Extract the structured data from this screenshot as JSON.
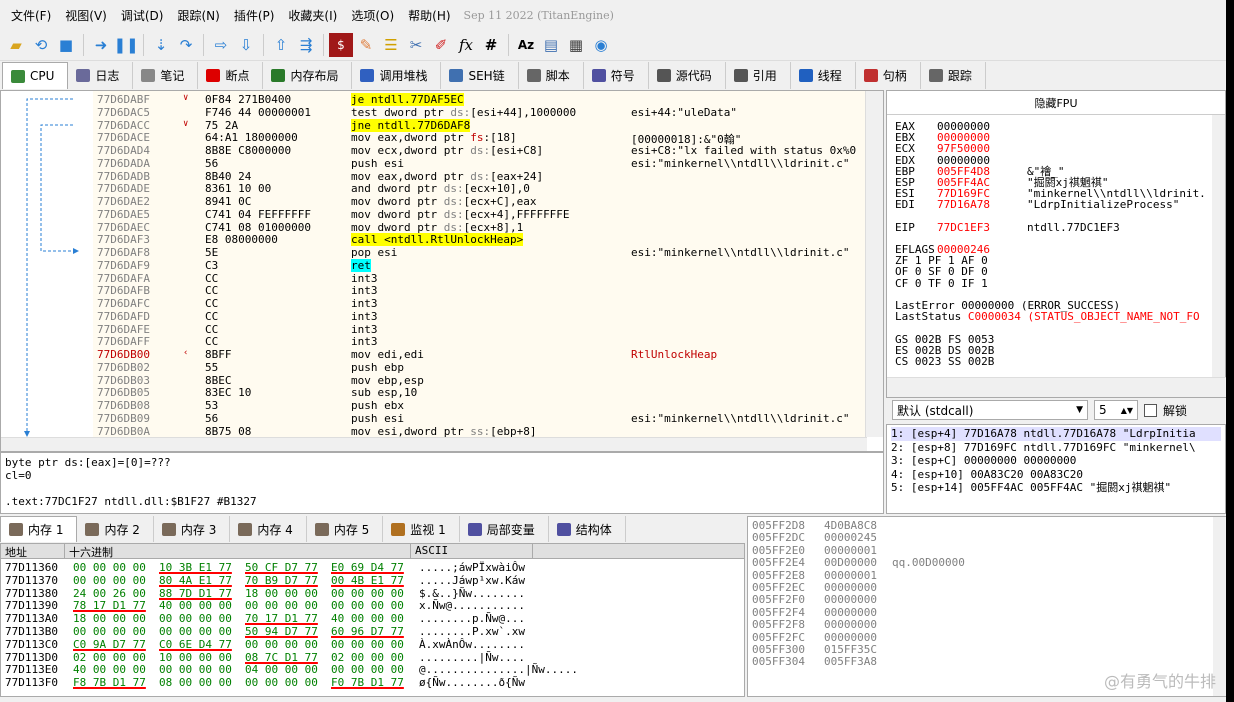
{
  "menubar": {
    "items": [
      "文件(F)",
      "视图(V)",
      "调试(D)",
      "跟踪(N)",
      "插件(P)",
      "收藏夹(I)",
      "选项(O)",
      "帮助(H)"
    ],
    "title": "Sep 11 2022 (TitanEngine)"
  },
  "tabs": [
    {
      "label": "CPU",
      "icon": "cpu-icon",
      "color": "#3a8a3a"
    },
    {
      "label": "日志",
      "icon": "log-icon",
      "color": "#6a6a9a"
    },
    {
      "label": "笔记",
      "icon": "notes-icon",
      "color": "#888"
    },
    {
      "label": "断点",
      "icon": "breakpoint-icon",
      "color": "#d00"
    },
    {
      "label": "内存布局",
      "icon": "memory-map-icon",
      "color": "#2a7a2a"
    },
    {
      "label": "调用堆栈",
      "icon": "call-stack-icon",
      "color": "#3060c0"
    },
    {
      "label": "SEH链",
      "icon": "seh-icon",
      "color": "#4070b0"
    },
    {
      "label": "脚本",
      "icon": "script-icon",
      "color": "#666"
    },
    {
      "label": "符号",
      "icon": "symbols-icon",
      "color": "#5050a0"
    },
    {
      "label": "源代码",
      "icon": "source-icon",
      "color": "#555"
    },
    {
      "label": "引用",
      "icon": "references-icon",
      "color": "#555"
    },
    {
      "label": "线程",
      "icon": "threads-icon",
      "color": "#2060c0"
    },
    {
      "label": "句柄",
      "icon": "handles-icon",
      "color": "#c03030"
    },
    {
      "label": "跟踪",
      "icon": "trace-icon",
      "color": "#666"
    }
  ],
  "disasm": [
    {
      "addr": "77D6DABF",
      "mark": "∨",
      "bytes": "0F84 271B0400",
      "ins": [
        [
          "j",
          "je ntdll.77DAF5EC"
        ]
      ],
      "cmt": ""
    },
    {
      "addr": "77D6DAC5",
      "mark": "",
      "bytes": "F746 44 00000001",
      "ins": [
        [
          "t",
          "test dword ptr "
        ],
        [
          "s",
          "ds:"
        ],
        [
          "t",
          "[esi+44],1000000"
        ]
      ],
      "cmt": "esi+44:\"uleData\""
    },
    {
      "addr": "77D6DACC",
      "mark": "∨",
      "bytes": "75 2A",
      "ins": [
        [
          "j",
          "jne ntdll.77D6DAF8"
        ]
      ],
      "cmt": ""
    },
    {
      "addr": "77D6DACE",
      "mark": "",
      "bytes": "64:A1 18000000",
      "ins": [
        [
          "t",
          "mov eax,dword ptr "
        ],
        [
          "r",
          "fs"
        ],
        [
          "t",
          ":[18]"
        ]
      ],
      "cmt": "[00000018]:&\"0翰\""
    },
    {
      "addr": "77D6DAD4",
      "mark": "",
      "bytes": "8B8E C8000000",
      "ins": [
        [
          "t",
          "mov ecx,dword ptr "
        ],
        [
          "s",
          "ds:"
        ],
        [
          "t",
          "[esi+C8]"
        ]
      ],
      "cmt": "esi+C8:\"lx failed with status 0x%0"
    },
    {
      "addr": "77D6DADA",
      "mark": "",
      "bytes": "56",
      "ins": [
        [
          "t",
          "push esi"
        ]
      ],
      "cmt": "esi:\"minkernel\\\\ntdll\\\\ldrinit.c\""
    },
    {
      "addr": "77D6DADB",
      "mark": "",
      "bytes": "8B40 24",
      "ins": [
        [
          "t",
          "mov eax,dword ptr "
        ],
        [
          "s",
          "ds:"
        ],
        [
          "t",
          "[eax+24]"
        ]
      ],
      "cmt": ""
    },
    {
      "addr": "77D6DADE",
      "mark": "",
      "bytes": "8361 10 00",
      "ins": [
        [
          "t",
          "and dword ptr "
        ],
        [
          "s",
          "ds:"
        ],
        [
          "t",
          "[ecx+10],0"
        ]
      ],
      "cmt": ""
    },
    {
      "addr": "77D6DAE2",
      "mark": "",
      "bytes": "8941 0C",
      "ins": [
        [
          "t",
          "mov dword ptr "
        ],
        [
          "s",
          "ds:"
        ],
        [
          "t",
          "[ecx+C],eax"
        ]
      ],
      "cmt": ""
    },
    {
      "addr": "77D6DAE5",
      "mark": "",
      "bytes": "C741 04 FEFFFFFF",
      "ins": [
        [
          "t",
          "mov dword ptr "
        ],
        [
          "s",
          "ds:"
        ],
        [
          "t",
          "[ecx+4],FFFFFFFE"
        ]
      ],
      "cmt": ""
    },
    {
      "addr": "77D6DAEC",
      "mark": "",
      "bytes": "C741 08 01000000",
      "ins": [
        [
          "t",
          "mov dword ptr "
        ],
        [
          "s",
          "ds:"
        ],
        [
          "t",
          "[ecx+8],1"
        ]
      ],
      "cmt": ""
    },
    {
      "addr": "77D6DAF3",
      "mark": "",
      "bytes": "E8 08000000",
      "ins": [
        [
          "c",
          "call <ntdll.RtlUnlockHeap>"
        ]
      ],
      "cmt": ""
    },
    {
      "addr": "77D6DAF8",
      "mark": "",
      "bytes": "5E",
      "ins": [
        [
          "t",
          "pop esi"
        ]
      ],
      "cmt": "esi:\"minkernel\\\\ntdll\\\\ldrinit.c\""
    },
    {
      "addr": "77D6DAF9",
      "mark": "",
      "bytes": "C3",
      "ins": [
        [
          "x",
          "ret"
        ]
      ],
      "cmt": ""
    },
    {
      "addr": "77D6DAFA",
      "mark": "",
      "bytes": "CC",
      "ins": [
        [
          "t",
          "int3"
        ]
      ],
      "cmt": ""
    },
    {
      "addr": "77D6DAFB",
      "mark": "",
      "bytes": "CC",
      "ins": [
        [
          "t",
          "int3"
        ]
      ],
      "cmt": ""
    },
    {
      "addr": "77D6DAFC",
      "mark": "",
      "bytes": "CC",
      "ins": [
        [
          "t",
          "int3"
        ]
      ],
      "cmt": ""
    },
    {
      "addr": "77D6DAFD",
      "mark": "",
      "bytes": "CC",
      "ins": [
        [
          "t",
          "int3"
        ]
      ],
      "cmt": ""
    },
    {
      "addr": "77D6DAFE",
      "mark": "",
      "bytes": "CC",
      "ins": [
        [
          "t",
          "int3"
        ]
      ],
      "cmt": ""
    },
    {
      "addr": "77D6DAFF",
      "mark": "",
      "bytes": "CC",
      "ins": [
        [
          "t",
          "int3"
        ]
      ],
      "cmt": ""
    },
    {
      "addr": "77D6DB00",
      "mark": "‹",
      "bytes": "8BFF",
      "ins": [
        [
          "t",
          "mov edi,edi"
        ]
      ],
      "cmt": "RtlUnlockHeap",
      "hl": true
    },
    {
      "addr": "77D6DB02",
      "mark": "",
      "bytes": "55",
      "ins": [
        [
          "t",
          "push ebp"
        ]
      ],
      "cmt": ""
    },
    {
      "addr": "77D6DB03",
      "mark": "",
      "bytes": "8BEC",
      "ins": [
        [
          "t",
          "mov ebp,esp"
        ]
      ],
      "cmt": ""
    },
    {
      "addr": "77D6DB05",
      "mark": "",
      "bytes": "83EC 10",
      "ins": [
        [
          "t",
          "sub esp,10"
        ]
      ],
      "cmt": ""
    },
    {
      "addr": "77D6DB08",
      "mark": "",
      "bytes": "53",
      "ins": [
        [
          "t",
          "push ebx"
        ]
      ],
      "cmt": ""
    },
    {
      "addr": "77D6DB09",
      "mark": "",
      "bytes": "56",
      "ins": [
        [
          "t",
          "push esi"
        ]
      ],
      "cmt": "esi:\"minkernel\\\\ntdll\\\\ldrinit.c\""
    },
    {
      "addr": "77D6DB0A",
      "mark": "",
      "bytes": "8B75 08",
      "ins": [
        [
          "t",
          "mov esi,dword ptr "
        ],
        [
          "s",
          "ss:"
        ],
        [
          "t",
          "[ebp+8]"
        ]
      ],
      "cmt": ""
    }
  ],
  "info": {
    "line1": "byte ptr ds:[eax]=[0]=???",
    "line2": "cl=0",
    "line3": ".text:77DC1F27 ntdll.dll:$B1F27 #B1327"
  },
  "regs": {
    "title": "隐藏FPU",
    "gp": [
      {
        "n": "EAX",
        "v": "00000000",
        "c": "",
        "red": false
      },
      {
        "n": "EBX",
        "v": "00000000",
        "c": "",
        "red": true
      },
      {
        "n": "ECX",
        "v": "97F50000",
        "c": "",
        "red": true
      },
      {
        "n": "EDX",
        "v": "00000000",
        "c": "",
        "red": false
      },
      {
        "n": "EBP",
        "v": "005FF4D8",
        "c": "&\"襘_\"",
        "red": true
      },
      {
        "n": "ESP",
        "v": "005FF4AC",
        "c": "\"掘閼xj祺魍祺\"",
        "red": true
      },
      {
        "n": "ESI",
        "v": "77D169FC",
        "c": "\"minkernel\\\\ntdll\\\\ldrinit.",
        "red": true
      },
      {
        "n": "EDI",
        "v": "77D16A78",
        "c": "\"LdrpInitializeProcess\"",
        "red": true
      }
    ],
    "eip": {
      "n": "EIP",
      "v": "77DC1EF3",
      "c": "ntdll.77DC1EF3"
    },
    "eflags": {
      "n": "EFLAGS",
      "v": "00000246"
    },
    "flags": [
      "ZF 1  PF 1  AF 0",
      "OF 0  SF 0  DF 0",
      "CF 0  TF 0  IF 1"
    ],
    "lasterror": {
      "n": "LastError",
      "v": "00000000 (ERROR_SUCCESS)"
    },
    "laststatus": {
      "n": "LastStatus",
      "v": "C0000034 (STATUS_OBJECT_NAME_NOT_FO"
    },
    "segs": [
      "GS 002B  FS 0053",
      "ES 002B  DS 002B",
      "CS 0023  SS 002B"
    ]
  },
  "callconv": {
    "label": "默认 (stdcall)",
    "count": "5",
    "unlock": "解锁"
  },
  "stackargs": [
    "1: [esp+4] 77D16A78 ntdll.77D16A78 \"LdrpInitia",
    "2: [esp+8] 77D169FC ntdll.77D169FC \"minkernel\\",
    "3: [esp+C] 00000000 00000000",
    "4: [esp+10] 00A83C20 00A83C20",
    "5: [esp+14] 005FF4AC 005FF4AC \"掘閼xj祺魍祺\""
  ],
  "dumptabs": [
    "内存 1",
    "内存 2",
    "内存 3",
    "内存 4",
    "内存 5",
    "监视 1",
    "局部变量",
    "结构体"
  ],
  "dumphead": {
    "addr": "地址",
    "hex": "十六进制",
    "ascii": "ASCII"
  },
  "dump": [
    {
      "a": "77D11360",
      "h": [
        "00 00 00 00",
        "10 3B E1 77",
        "50 CF D7 77",
        "E0 69 D4 77"
      ],
      "t": ".....;áwPÏxwàiÔw"
    },
    {
      "a": "77D11370",
      "h": [
        "00 00 00 00",
        "80 4A E1 77",
        "70 B9 D7 77",
        "00 4B E1 77"
      ],
      "t": ".....Jáwp¹xw.Káw"
    },
    {
      "a": "77D11380",
      "h": [
        "24 00 26 00",
        "88 7D D1 77",
        "18 00 00 00",
        "00 00 00 00"
      ],
      "t": "$.&..}Ñw........"
    },
    {
      "a": "77D11390",
      "h": [
        "78 17 D1 77",
        "40 00 00 00",
        "00 00 00 00",
        "00 00 00 00"
      ],
      "t": "x.Ñw@..........."
    },
    {
      "a": "77D113A0",
      "h": [
        "18 00 00 00",
        "00 00 00 00",
        "70 17 D1 77",
        "40 00 00 00"
      ],
      "t": "........p.Ñw@..."
    },
    {
      "a": "77D113B0",
      "h": [
        "00 00 00 00",
        "00 00 00 00",
        "50 94 D7 77",
        "60 96 D7 77"
      ],
      "t": "........P.xw`.xw"
    },
    {
      "a": "77D113C0",
      "h": [
        "C0 9A D7 77",
        "C0 6E D4 77",
        "00 00 00 00",
        "00 00 00 00"
      ],
      "t": "À.xwÀnÔw........"
    },
    {
      "a": "77D113D0",
      "h": [
        "02 00 00 00",
        "10 00 00 00",
        "08 7C D1 77",
        "02 00 00 00"
      ],
      "t": ".........|Ñw...."
    },
    {
      "a": "77D113E0",
      "h": [
        "40 00 00 00",
        "00 00 00 00",
        "04 00 00 00",
        "00 00 00 00"
      ],
      "t": "@...............|Ñw....."
    },
    {
      "a": "77D113F0",
      "h": [
        "F8 7B D1 77",
        "08 00 00 00",
        "00 00 00 00",
        "F0 7B D1 77"
      ],
      "t": "ø{Ñw........ð{Ñw"
    }
  ],
  "stack": [
    {
      "a": "005FF2D8",
      "v": "4D0BA8C8",
      "c": ""
    },
    {
      "a": "005FF2DC",
      "v": "00000245",
      "c": ""
    },
    {
      "a": "005FF2E0",
      "v": "00000001",
      "c": ""
    },
    {
      "a": "005FF2E4",
      "v": "00D00000",
      "c": "qq.00D00000"
    },
    {
      "a": "005FF2E8",
      "v": "00000001",
      "c": ""
    },
    {
      "a": "005FF2EC",
      "v": "00000000",
      "c": ""
    },
    {
      "a": "005FF2F0",
      "v": "00000000",
      "c": ""
    },
    {
      "a": "005FF2F4",
      "v": "00000000",
      "c": ""
    },
    {
      "a": "005FF2F8",
      "v": "00000000",
      "c": ""
    },
    {
      "a": "005FF2FC",
      "v": "00000000",
      "c": ""
    },
    {
      "a": "005FF300",
      "v": "015FF35C",
      "c": ""
    },
    {
      "a": "005FF304",
      "v": "005FF3A8",
      "c": ""
    }
  ],
  "watermark": "@有勇气的牛排"
}
